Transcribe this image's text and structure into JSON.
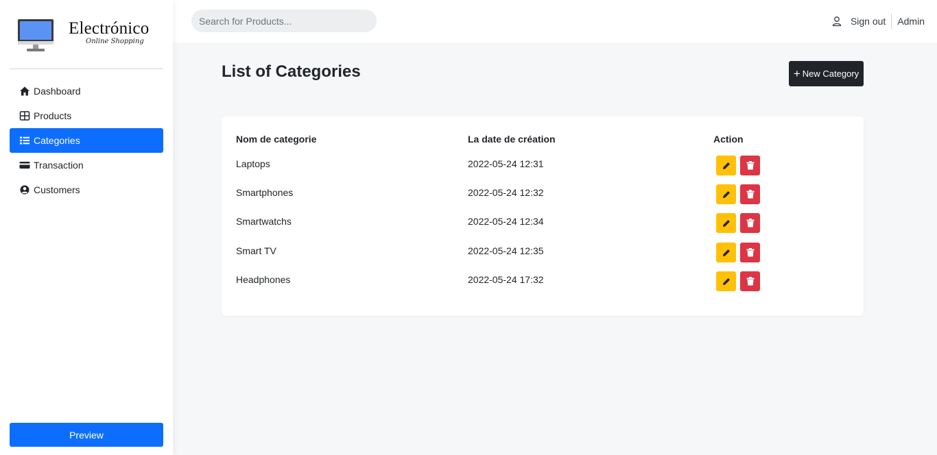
{
  "brand": {
    "name": "Electrónico",
    "tagline": "Online Shopping"
  },
  "sidebar": {
    "items": [
      {
        "label": "Dashboard",
        "icon": "house-icon",
        "active": false
      },
      {
        "label": "Products",
        "icon": "grid-icon",
        "active": false
      },
      {
        "label": "Categories",
        "icon": "list-icon",
        "active": true
      },
      {
        "label": "Transaction",
        "icon": "credit-card-icon",
        "active": false
      },
      {
        "label": "Customers",
        "icon": "person-circle-icon",
        "active": false
      }
    ],
    "preview_label": "Preview"
  },
  "header": {
    "search_placeholder": "Search for Products...",
    "signout_label": "Sign out",
    "user_name": "Admin"
  },
  "main": {
    "title": "List of Categories",
    "new_button_label": "New Category",
    "table": {
      "columns": [
        "Nom de categorie",
        "La date de création",
        "Action"
      ],
      "rows": [
        {
          "name": "Laptops",
          "date": "2022-05-24 12:31"
        },
        {
          "name": "Smartphones",
          "date": "2022-05-24 12:32"
        },
        {
          "name": "Smartwatchs",
          "date": "2022-05-24 12:34"
        },
        {
          "name": "Smart TV",
          "date": "2022-05-24 12:35"
        },
        {
          "name": "Headphones",
          "date": "2022-05-24 17:32"
        }
      ]
    }
  },
  "colors": {
    "primary": "#0d6efd",
    "dark": "#212529",
    "warning": "#ffc107",
    "danger": "#dc3545",
    "background": "#f6f7f9"
  }
}
